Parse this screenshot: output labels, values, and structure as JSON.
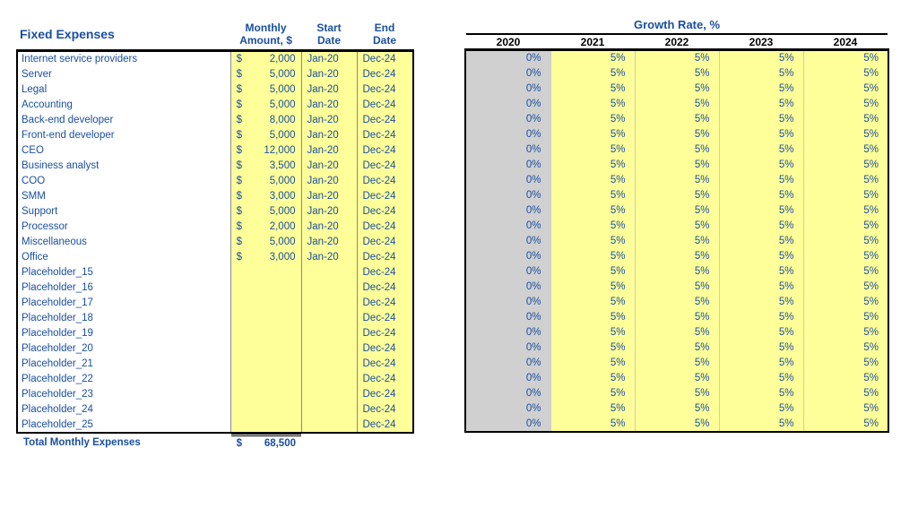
{
  "left": {
    "title": "Fixed Expenses",
    "headers": {
      "amount": "Monthly\nAmount, $",
      "start": "Start\nDate",
      "end": "End Date"
    },
    "currency": "$",
    "rows": [
      {
        "name": "Internet service providers",
        "amount": "2,000",
        "start": "Jan-20",
        "end": "Dec-24"
      },
      {
        "name": "Server",
        "amount": "5,000",
        "start": "Jan-20",
        "end": "Dec-24"
      },
      {
        "name": "Legal",
        "amount": "5,000",
        "start": "Jan-20",
        "end": "Dec-24"
      },
      {
        "name": "Accounting",
        "amount": "5,000",
        "start": "Jan-20",
        "end": "Dec-24"
      },
      {
        "name": "Back-end developer",
        "amount": "8,000",
        "start": "Jan-20",
        "end": "Dec-24"
      },
      {
        "name": "Front-end developer",
        "amount": "5,000",
        "start": "Jan-20",
        "end": "Dec-24"
      },
      {
        "name": "CEO",
        "amount": "12,000",
        "start": "Jan-20",
        "end": "Dec-24"
      },
      {
        "name": "Business analyst",
        "amount": "3,500",
        "start": "Jan-20",
        "end": "Dec-24"
      },
      {
        "name": "COO",
        "amount": "5,000",
        "start": "Jan-20",
        "end": "Dec-24"
      },
      {
        "name": "SMM",
        "amount": "3,000",
        "start": "Jan-20",
        "end": "Dec-24"
      },
      {
        "name": "Support",
        "amount": "5,000",
        "start": "Jan-20",
        "end": "Dec-24"
      },
      {
        "name": "Processor",
        "amount": "2,000",
        "start": "Jan-20",
        "end": "Dec-24"
      },
      {
        "name": "Miscellaneous",
        "amount": "5,000",
        "start": "Jan-20",
        "end": "Dec-24"
      },
      {
        "name": "Office",
        "amount": "3,000",
        "start": "Jan-20",
        "end": "Dec-24"
      },
      {
        "name": "Placeholder_15",
        "amount": "",
        "start": "",
        "end": "Dec-24"
      },
      {
        "name": "Placeholder_16",
        "amount": "",
        "start": "",
        "end": "Dec-24"
      },
      {
        "name": "Placeholder_17",
        "amount": "",
        "start": "",
        "end": "Dec-24"
      },
      {
        "name": "Placeholder_18",
        "amount": "",
        "start": "",
        "end": "Dec-24"
      },
      {
        "name": "Placeholder_19",
        "amount": "",
        "start": "",
        "end": "Dec-24"
      },
      {
        "name": "Placeholder_20",
        "amount": "",
        "start": "",
        "end": "Dec-24"
      },
      {
        "name": "Placeholder_21",
        "amount": "",
        "start": "",
        "end": "Dec-24"
      },
      {
        "name": "Placeholder_22",
        "amount": "",
        "start": "",
        "end": "Dec-24"
      },
      {
        "name": "Placeholder_23",
        "amount": "",
        "start": "",
        "end": "Dec-24"
      },
      {
        "name": "Placeholder_24",
        "amount": "",
        "start": "",
        "end": "Dec-24"
      },
      {
        "name": "Placeholder_25",
        "amount": "",
        "start": "",
        "end": "Dec-24"
      }
    ],
    "summary": {
      "label": "Total Monthly Expenses",
      "symbol": "$",
      "value": "68,500"
    }
  },
  "right": {
    "title": "Growth Rate, %",
    "years": [
      "2020",
      "2021",
      "2022",
      "2023",
      "2024"
    ],
    "rows": [
      [
        "0%",
        "5%",
        "5%",
        "5%",
        "5%"
      ],
      [
        "0%",
        "5%",
        "5%",
        "5%",
        "5%"
      ],
      [
        "0%",
        "5%",
        "5%",
        "5%",
        "5%"
      ],
      [
        "0%",
        "5%",
        "5%",
        "5%",
        "5%"
      ],
      [
        "0%",
        "5%",
        "5%",
        "5%",
        "5%"
      ],
      [
        "0%",
        "5%",
        "5%",
        "5%",
        "5%"
      ],
      [
        "0%",
        "5%",
        "5%",
        "5%",
        "5%"
      ],
      [
        "0%",
        "5%",
        "5%",
        "5%",
        "5%"
      ],
      [
        "0%",
        "5%",
        "5%",
        "5%",
        "5%"
      ],
      [
        "0%",
        "5%",
        "5%",
        "5%",
        "5%"
      ],
      [
        "0%",
        "5%",
        "5%",
        "5%",
        "5%"
      ],
      [
        "0%",
        "5%",
        "5%",
        "5%",
        "5%"
      ],
      [
        "0%",
        "5%",
        "5%",
        "5%",
        "5%"
      ],
      [
        "0%",
        "5%",
        "5%",
        "5%",
        "5%"
      ],
      [
        "0%",
        "5%",
        "5%",
        "5%",
        "5%"
      ],
      [
        "0%",
        "5%",
        "5%",
        "5%",
        "5%"
      ],
      [
        "0%",
        "5%",
        "5%",
        "5%",
        "5%"
      ],
      [
        "0%",
        "5%",
        "5%",
        "5%",
        "5%"
      ],
      [
        "0%",
        "5%",
        "5%",
        "5%",
        "5%"
      ],
      [
        "0%",
        "5%",
        "5%",
        "5%",
        "5%"
      ],
      [
        "0%",
        "5%",
        "5%",
        "5%",
        "5%"
      ],
      [
        "0%",
        "5%",
        "5%",
        "5%",
        "5%"
      ],
      [
        "0%",
        "5%",
        "5%",
        "5%",
        "5%"
      ],
      [
        "0%",
        "5%",
        "5%",
        "5%",
        "5%"
      ],
      [
        "0%",
        "5%",
        "5%",
        "5%",
        "5%"
      ]
    ]
  }
}
